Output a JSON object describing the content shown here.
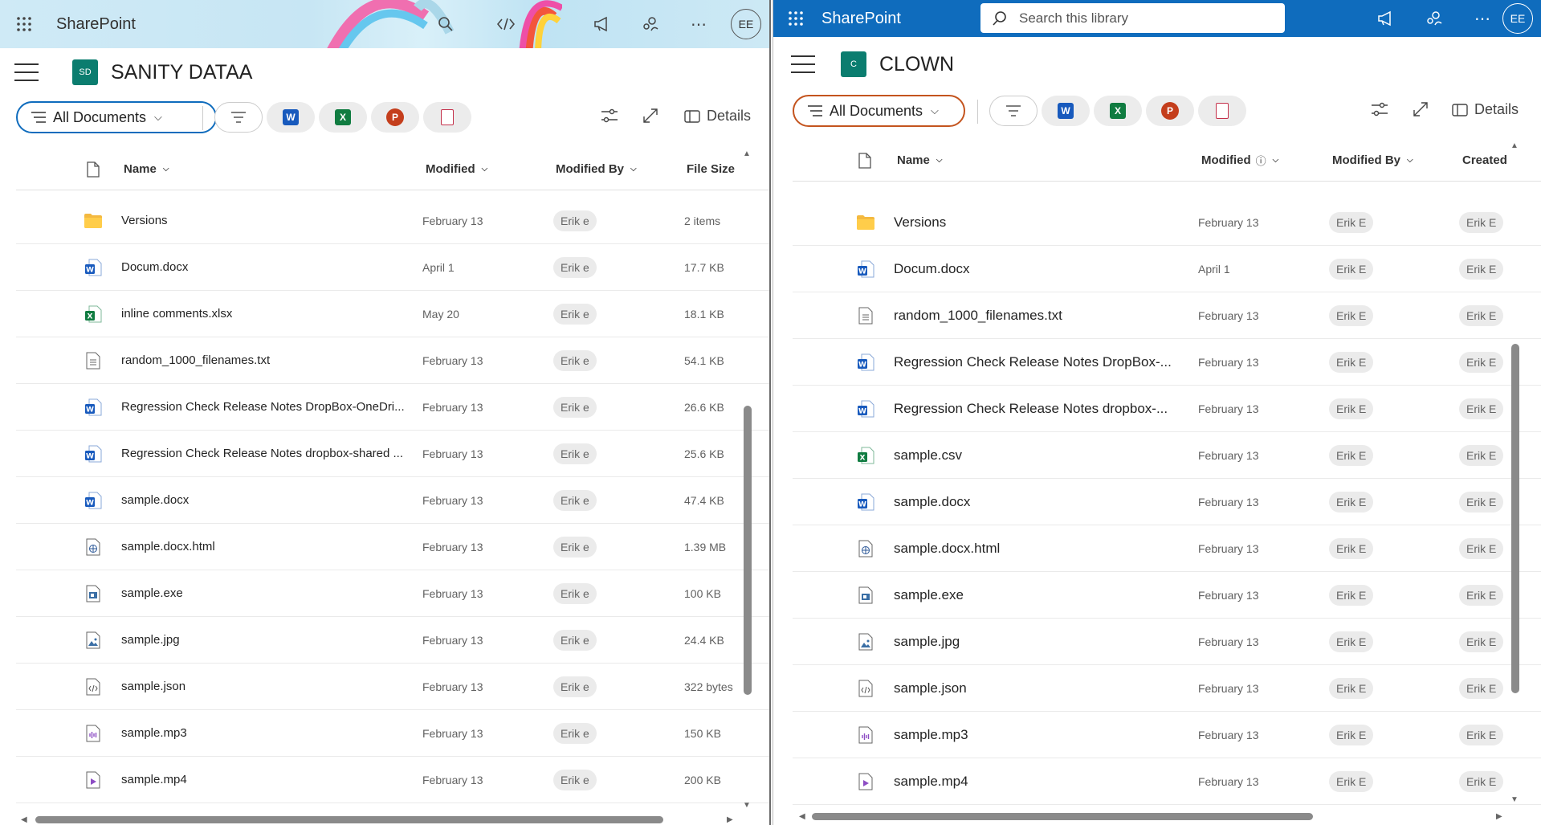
{
  "left": {
    "brand": "SharePoint",
    "avatar": "EE",
    "site_logo": "SD",
    "site_title": "SANITY DATAA",
    "view_label": "All Documents",
    "details_label": "Details",
    "columns": {
      "name": "Name",
      "modified": "Modified",
      "modified_by": "Modified By",
      "file_size": "File Size"
    },
    "rows": [
      {
        "icon": "folder-icon",
        "name": "Versions",
        "modified": "February 13",
        "by": "Erik e",
        "size": "2 items"
      },
      {
        "icon": "word-file-icon",
        "name": "Docum.docx",
        "modified": "April 1",
        "by": "Erik e",
        "size": "17.7 KB"
      },
      {
        "icon": "excel-file-icon",
        "name": "inline comments.xlsx",
        "modified": "May 20",
        "by": "Erik e",
        "size": "18.1 KB"
      },
      {
        "icon": "text-file-icon",
        "name": "random_1000_filenames.txt",
        "modified": "February 13",
        "by": "Erik e",
        "size": "54.1 KB"
      },
      {
        "icon": "word-file-icon",
        "name": "Regression Check Release Notes DropBox-OneDri...",
        "modified": "February 13",
        "by": "Erik e",
        "size": "26.6 KB"
      },
      {
        "icon": "word-file-icon",
        "name": "Regression Check Release Notes dropbox-shared ...",
        "modified": "February 13",
        "by": "Erik e",
        "size": "25.6 KB"
      },
      {
        "icon": "word-file-icon",
        "name": "sample.docx",
        "modified": "February 13",
        "by": "Erik e",
        "size": "47.4 KB"
      },
      {
        "icon": "html-file-icon",
        "name": "sample.docx.html",
        "modified": "February 13",
        "by": "Erik e",
        "size": "1.39 MB"
      },
      {
        "icon": "exe-file-icon",
        "name": "sample.exe",
        "modified": "February 13",
        "by": "Erik e",
        "size": "100 KB"
      },
      {
        "icon": "image-file-icon",
        "name": "sample.jpg",
        "modified": "February 13",
        "by": "Erik e",
        "size": "24.4 KB"
      },
      {
        "icon": "code-file-icon",
        "name": "sample.json",
        "modified": "February 13",
        "by": "Erik e",
        "size": "322 bytes"
      },
      {
        "icon": "audio-file-icon",
        "name": "sample.mp3",
        "modified": "February 13",
        "by": "Erik e",
        "size": "150 KB"
      },
      {
        "icon": "video-file-icon",
        "name": "sample.mp4",
        "modified": "February 13",
        "by": "Erik e",
        "size": "200 KB"
      }
    ]
  },
  "right": {
    "brand": "SharePoint",
    "avatar": "EE",
    "search_placeholder": "Search this library",
    "site_logo": "C",
    "site_title": "CLOWN",
    "view_label": "All Documents",
    "details_label": "Details",
    "columns": {
      "name": "Name",
      "modified": "Modified",
      "modified_by": "Modified By",
      "created": "Created"
    },
    "rows": [
      {
        "icon": "folder-icon",
        "name": "Versions",
        "modified": "February 13",
        "by": "Erik E",
        "created": "Erik E"
      },
      {
        "icon": "word-file-icon",
        "name": "Docum.docx",
        "modified": "April 1",
        "by": "Erik E",
        "created": "Erik E"
      },
      {
        "icon": "text-file-icon",
        "name": "random_1000_filenames.txt",
        "modified": "February 13",
        "by": "Erik E",
        "created": "Erik E"
      },
      {
        "icon": "word-file-icon",
        "name": "Regression Check Release Notes DropBox-...",
        "modified": "February 13",
        "by": "Erik E",
        "created": "Erik E"
      },
      {
        "icon": "word-file-icon",
        "name": "Regression Check Release Notes dropbox-...",
        "modified": "February 13",
        "by": "Erik E",
        "created": "Erik E"
      },
      {
        "icon": "excel-file-icon",
        "name": "sample.csv",
        "modified": "February 13",
        "by": "Erik E",
        "created": "Erik E"
      },
      {
        "icon": "word-file-icon",
        "name": "sample.docx",
        "modified": "February 13",
        "by": "Erik E",
        "created": "Erik E"
      },
      {
        "icon": "html-file-icon",
        "name": "sample.docx.html",
        "modified": "February 13",
        "by": "Erik E",
        "created": "Erik E"
      },
      {
        "icon": "exe-file-icon",
        "name": "sample.exe",
        "modified": "February 13",
        "by": "Erik E",
        "created": "Erik E"
      },
      {
        "icon": "image-file-icon",
        "name": "sample.jpg",
        "modified": "February 13",
        "by": "Erik E",
        "created": "Erik E"
      },
      {
        "icon": "code-file-icon",
        "name": "sample.json",
        "modified": "February 13",
        "by": "Erik E",
        "created": "Erik E"
      },
      {
        "icon": "audio-file-icon",
        "name": "sample.mp3",
        "modified": "February 13",
        "by": "Erik E",
        "created": "Erik E"
      },
      {
        "icon": "video-file-icon",
        "name": "sample.mp4",
        "modified": "February 13",
        "by": "Erik E",
        "created": "Erik E"
      }
    ]
  },
  "colors": {
    "accent_blue": "#0f6cbd",
    "word": "#185abd",
    "excel": "#107c41",
    "powerpoint": "#c43e1c",
    "folder": "#f4b940",
    "site_logo": "#0b7d6f"
  }
}
